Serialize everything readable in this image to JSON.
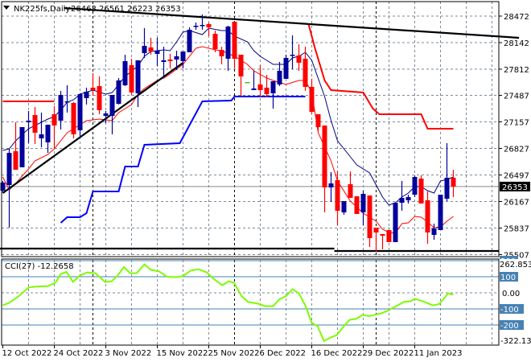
{
  "header": {
    "symbol": "NK225fs,Daily",
    "ohlc": "26463 26561 26223 26353"
  },
  "colors": {
    "bull": "#00009c",
    "bear": "#ff0000",
    "doji": "#32cd32",
    "ma_fast": "#000080",
    "ma_slow": "#ff0000",
    "step_upper": "#ff0000",
    "step_lower": "#0000ff",
    "trendline": "#000000",
    "grid": "#7d8a99",
    "cci_line": "#7cfc00",
    "cci_level": "#4682b4"
  },
  "chart_data": [
    {
      "type": "candlestick",
      "title": "NK225fs,Daily",
      "ylim": [
        25507,
        28472
      ],
      "grid": true,
      "y_ticks": [
        "28472",
        "28142",
        "27812",
        "27487",
        "27157",
        "26827",
        "26497",
        "26167",
        "25837",
        "25507"
      ],
      "x_labels": [
        {
          "bar": 0,
          "label": "12 Oct 2022"
        },
        {
          "bar": 8,
          "label": "24 Oct 2022"
        },
        {
          "bar": 16,
          "label": "3 Nov 2022"
        },
        {
          "bar": 24,
          "label": "15 Nov 2022"
        },
        {
          "bar": 32,
          "label": "25 Nov 2022"
        },
        {
          "bar": 40,
          "label": "6 Dec 2022"
        },
        {
          "bar": 48,
          "label": "16 Dec 2022"
        },
        {
          "bar": 56,
          "label": "29 Dec 2022"
        },
        {
          "bar": 64,
          "label": "11 Jan 2023"
        }
      ],
      "month_separators": [
        14,
        36,
        58
      ],
      "current_price": "26353",
      "ohlc": [
        [
          26302,
          26422,
          26272,
          26402
        ],
        [
          26372,
          26822,
          25842,
          26772
        ],
        [
          26792,
          27152,
          26562,
          26562
        ],
        [
          26592,
          27092,
          26592,
          27092
        ],
        [
          27152,
          27292,
          26892,
          27172
        ],
        [
          27242,
          27342,
          26882,
          27022
        ],
        [
          26952,
          27272,
          26842,
          27002
        ],
        [
          26902,
          27122,
          26772,
          27122
        ],
        [
          27252,
          27352,
          26832,
          27112
        ],
        [
          27172,
          27542,
          27062,
          27492
        ],
        [
          27402,
          27612,
          27272,
          27412
        ],
        [
          27392,
          27402,
          26952,
          27002
        ],
        [
          27052,
          27512,
          26952,
          27502
        ],
        [
          27452,
          27582,
          27372,
          27532
        ],
        [
          27582,
          27762,
          27482,
          27552
        ],
        [
          27602,
          27722,
          27252,
          27302
        ],
        [
          27232,
          27292,
          27142,
          27262
        ],
        [
          27232,
          27492,
          27002,
          27492
        ],
        [
          27382,
          27702,
          27372,
          27672
        ],
        [
          27612,
          27992,
          27602,
          27912
        ],
        [
          27862,
          27942,
          27492,
          27522
        ],
        [
          27512,
          27922,
          27342,
          27922
        ],
        [
          28012,
          28322,
          27952,
          28102
        ],
        [
          28082,
          28202,
          27992,
          28032
        ],
        [
          28002,
          28202,
          27852,
          28042
        ],
        [
          27902,
          28092,
          27702,
          27922
        ],
        [
          27932,
          28002,
          27822,
          27912
        ],
        [
          27932,
          28042,
          27802,
          27972
        ],
        [
          27912,
          28032,
          27822,
          28032
        ],
        [
          28022,
          28332,
          28022,
          28302
        ],
        [
          28342,
          28392,
          28302,
          28352
        ],
        [
          28352,
          28492,
          28302,
          28362
        ],
        [
          28372,
          28392,
          28222,
          28332
        ],
        [
          28252,
          28292,
          28022,
          28062
        ],
        [
          28052,
          28092,
          27872,
          27972
        ],
        [
          27942,
          28352,
          27792,
          28342
        ],
        [
          28402,
          28402,
          27822,
          27942
        ],
        [
          27992,
          27992,
          27472,
          27722
        ],
        [
          27652,
          27652,
          27652,
          27652
        ],
        [
          27552,
          27792,
          27552,
          27572
        ],
        [
          27622,
          27862,
          27462,
          27552
        ],
        [
          27582,
          27742,
          27462,
          27502
        ],
        [
          27512,
          27662,
          27322,
          27662
        ],
        [
          27622,
          27902,
          27602,
          27792
        ],
        [
          27692,
          27992,
          27692,
          27952
        ],
        [
          27982,
          28232,
          27812,
          27992
        ],
        [
          27982,
          28122,
          27792,
          27892
        ],
        [
          27942,
          28092,
          27542,
          27592
        ],
        [
          27592,
          27692,
          27262,
          27282
        ],
        [
          27252,
          27252,
          27042,
          27092
        ],
        [
          27112,
          27112,
          26032,
          26342
        ],
        [
          26342,
          26532,
          26162,
          26392
        ],
        [
          26432,
          26542,
          25872,
          26052
        ],
        [
          26032,
          26172,
          26002,
          26172
        ],
        [
          26382,
          26542,
          26212,
          26212
        ],
        [
          26232,
          26232,
          26012,
          26012
        ],
        [
          26032,
          26302,
          25872,
          26262
        ],
        [
          26242,
          26242,
          25602,
          25712
        ],
        [
          25842,
          25842,
          25542,
          25782
        ],
        [
          25762,
          25762,
          25572,
          25742
        ],
        [
          25812,
          25812,
          25662,
          25662
        ],
        [
          25662,
          26152,
          25662,
          26152
        ],
        [
          26152,
          26422,
          26052,
          26212
        ],
        [
          26182,
          26252,
          26142,
          26222
        ],
        [
          26252,
          26492,
          26222,
          26472
        ],
        [
          26452,
          26492,
          26142,
          26142
        ],
        [
          26182,
          26292,
          25642,
          25782
        ],
        [
          25752,
          25892,
          25692,
          25832
        ],
        [
          25812,
          26252,
          25812,
          26252
        ],
        [
          26202,
          26892,
          26172,
          26462
        ],
        [
          26463,
          26561,
          26223,
          26353
        ]
      ],
      "ma_fast": [
        [
          0,
          26802
        ],
        [
          1,
          26822
        ],
        [
          2,
          26922
        ],
        [
          4,
          27072
        ],
        [
          6,
          27152
        ],
        [
          7,
          27192
        ],
        [
          8,
          27222
        ],
        [
          9,
          27302
        ],
        [
          10,
          27402
        ],
        [
          11,
          27432
        ],
        [
          12,
          27502
        ],
        [
          14,
          27552
        ],
        [
          16,
          27502
        ],
        [
          17,
          27522
        ],
        [
          18,
          27622
        ],
        [
          19,
          27722
        ],
        [
          21,
          27852
        ],
        [
          22,
          27972
        ],
        [
          23,
          28032
        ],
        [
          25,
          28052
        ],
        [
          26,
          28042
        ],
        [
          27,
          28152
        ],
        [
          28,
          28272
        ],
        [
          29,
          28292
        ],
        [
          31,
          28242
        ],
        [
          32,
          28322
        ],
        [
          34,
          28292
        ],
        [
          35,
          28292
        ],
        [
          36,
          28222
        ],
        [
          38,
          28152
        ],
        [
          39,
          28042
        ],
        [
          40,
          27972
        ],
        [
          41,
          27922
        ],
        [
          42,
          27872
        ],
        [
          44,
          27872
        ],
        [
          45,
          27952
        ],
        [
          46,
          27972
        ],
        [
          47,
          28022
        ],
        [
          48,
          27922
        ],
        [
          50,
          27472
        ],
        [
          51,
          27172
        ],
        [
          52,
          26922
        ],
        [
          54,
          26722
        ],
        [
          55,
          26622
        ],
        [
          57,
          26522
        ],
        [
          58,
          26372
        ],
        [
          59,
          26222
        ],
        [
          60,
          26122
        ],
        [
          61,
          26152
        ],
        [
          62,
          26222
        ],
        [
          63,
          26272
        ],
        [
          64,
          26352
        ],
        [
          65,
          26352
        ],
        [
          66,
          26302
        ],
        [
          67,
          26272
        ],
        [
          68,
          26422
        ],
        [
          69,
          26442
        ],
        [
          70,
          26472
        ]
      ],
      "ma_slow": [
        [
          0,
          26472
        ],
        [
          1,
          26312
        ],
        [
          2,
          26392
        ],
        [
          4,
          26572
        ],
        [
          5,
          26672
        ],
        [
          7,
          26752
        ],
        [
          8,
          26822
        ],
        [
          10,
          27022
        ],
        [
          12,
          27122
        ],
        [
          13,
          27172
        ],
        [
          15,
          27192
        ],
        [
          17,
          27172
        ],
        [
          18,
          27272
        ],
        [
          20,
          27372
        ],
        [
          21,
          27502
        ],
        [
          22,
          27572
        ],
        [
          24,
          27672
        ],
        [
          25,
          27702
        ],
        [
          26,
          27752
        ],
        [
          28,
          27872
        ],
        [
          30,
          28072
        ],
        [
          31,
          28092
        ],
        [
          33,
          28052
        ],
        [
          34,
          28042
        ],
        [
          36,
          27972
        ],
        [
          38,
          27872
        ],
        [
          39,
          27792
        ],
        [
          41,
          27702
        ],
        [
          42,
          27672
        ],
        [
          44,
          27622
        ],
        [
          46,
          27672
        ],
        [
          47,
          27672
        ],
        [
          48,
          27522
        ],
        [
          49,
          27022
        ],
        [
          51,
          26672
        ],
        [
          52,
          26422
        ],
        [
          54,
          26172
        ],
        [
          56,
          26022
        ],
        [
          58,
          25922
        ],
        [
          59,
          25822
        ],
        [
          60,
          25782
        ],
        [
          61,
          25772
        ],
        [
          62,
          25892
        ],
        [
          63,
          25902
        ],
        [
          64,
          25982
        ],
        [
          65,
          25972
        ],
        [
          66,
          25912
        ],
        [
          67,
          25842
        ],
        [
          68,
          25852
        ],
        [
          69,
          25922
        ],
        [
          70,
          25982
        ]
      ],
      "step_upper": [
        [
          [
            0,
            27412
          ],
          [
            8,
            27412
          ]
        ],
        [
          [
            47.5,
            28372
          ],
          [
            48.5,
            28072
          ],
          [
            50,
            27672
          ],
          [
            51,
            27552
          ],
          [
            56,
            27522
          ],
          [
            57.5,
            27322
          ],
          [
            58.5,
            27252
          ],
          [
            65,
            27252
          ],
          [
            66,
            27072
          ],
          [
            70,
            27072
          ]
        ]
      ],
      "step_lower": [
        [
          9,
          25902
        ],
        [
          10,
          25972
        ],
        [
          12,
          25972
        ],
        [
          13,
          26022
        ],
        [
          14,
          26292
        ],
        [
          18,
          26292
        ],
        [
          19,
          26602
        ],
        [
          21,
          26602
        ],
        [
          22,
          26872
        ],
        [
          27.5,
          26892
        ],
        [
          31,
          27412
        ],
        [
          35.5,
          27422
        ],
        [
          36,
          27472
        ],
        [
          47,
          27472
        ]
      ],
      "trendlines": [
        [
          [
            0,
            26272
          ],
          [
            28,
            27892
          ]
        ],
        [
          [
            9.5,
            28572
          ],
          [
            80.2,
            28202
          ]
        ],
        [
          [
            -0.5,
            25582
          ],
          [
            51.5,
            25582
          ]
        ],
        [
          [
            51.5,
            25552
          ],
          [
            77,
            25552
          ]
        ]
      ]
    },
    {
      "type": "line",
      "title": "CCI(27)",
      "last_value": "-12.2658",
      "scale_max": "262.8534",
      "scale_min": "-322.133",
      "levels": [
        {
          "value": 200,
          "label": "200"
        },
        {
          "value": 100,
          "label": "100"
        },
        {
          "value": -100,
          "label": "-100"
        },
        {
          "value": -200,
          "label": "-200"
        }
      ],
      "zero_label": "0.00",
      "values": [
        [
          0,
          -78
        ],
        [
          1,
          -62
        ],
        [
          2.5,
          -20
        ],
        [
          4,
          33
        ],
        [
          5,
          38
        ],
        [
          7,
          42
        ],
        [
          8.2,
          63
        ],
        [
          9,
          117
        ],
        [
          9.9,
          130
        ],
        [
          10.9,
          68
        ],
        [
          11.9,
          105
        ],
        [
          13.1,
          127
        ],
        [
          14.4,
          122
        ],
        [
          15.9,
          67
        ],
        [
          16.9,
          72
        ],
        [
          17.8,
          105
        ],
        [
          18.8,
          160
        ],
        [
          19.8,
          122
        ],
        [
          20.8,
          122
        ],
        [
          22,
          177
        ],
        [
          23,
          143
        ],
        [
          24.3,
          133
        ],
        [
          25.5,
          100
        ],
        [
          27,
          97
        ],
        [
          28,
          105
        ],
        [
          29.2,
          138
        ],
        [
          30.4,
          147
        ],
        [
          31.7,
          127
        ],
        [
          32.7,
          88
        ],
        [
          34.1,
          47
        ],
        [
          35.1,
          72
        ],
        [
          35.9,
          63
        ],
        [
          37.1,
          -20
        ],
        [
          38.1,
          -57
        ],
        [
          39.6,
          -67
        ],
        [
          40.8,
          -83
        ],
        [
          42,
          -83
        ],
        [
          43,
          -40
        ],
        [
          44,
          -20
        ],
        [
          45,
          22
        ],
        [
          46,
          -3
        ],
        [
          47,
          -78
        ],
        [
          48,
          -187
        ],
        [
          48.9,
          -207
        ],
        [
          49.9,
          -300
        ],
        [
          50.9,
          -278
        ],
        [
          51.9,
          -262
        ],
        [
          52.9,
          -212
        ],
        [
          53.9,
          -167
        ],
        [
          54.9,
          -162
        ],
        [
          55.9,
          -137
        ],
        [
          56.9,
          -145
        ],
        [
          58.8,
          -128
        ],
        [
          59.8,
          -112
        ],
        [
          61.1,
          -83
        ],
        [
          62.3,
          -57
        ],
        [
          63.3,
          -53
        ],
        [
          64,
          -37
        ],
        [
          65.3,
          -53
        ],
        [
          66.8,
          -78
        ],
        [
          67.8,
          -70
        ],
        [
          69.2,
          -3
        ],
        [
          70,
          -12
        ]
      ]
    }
  ]
}
